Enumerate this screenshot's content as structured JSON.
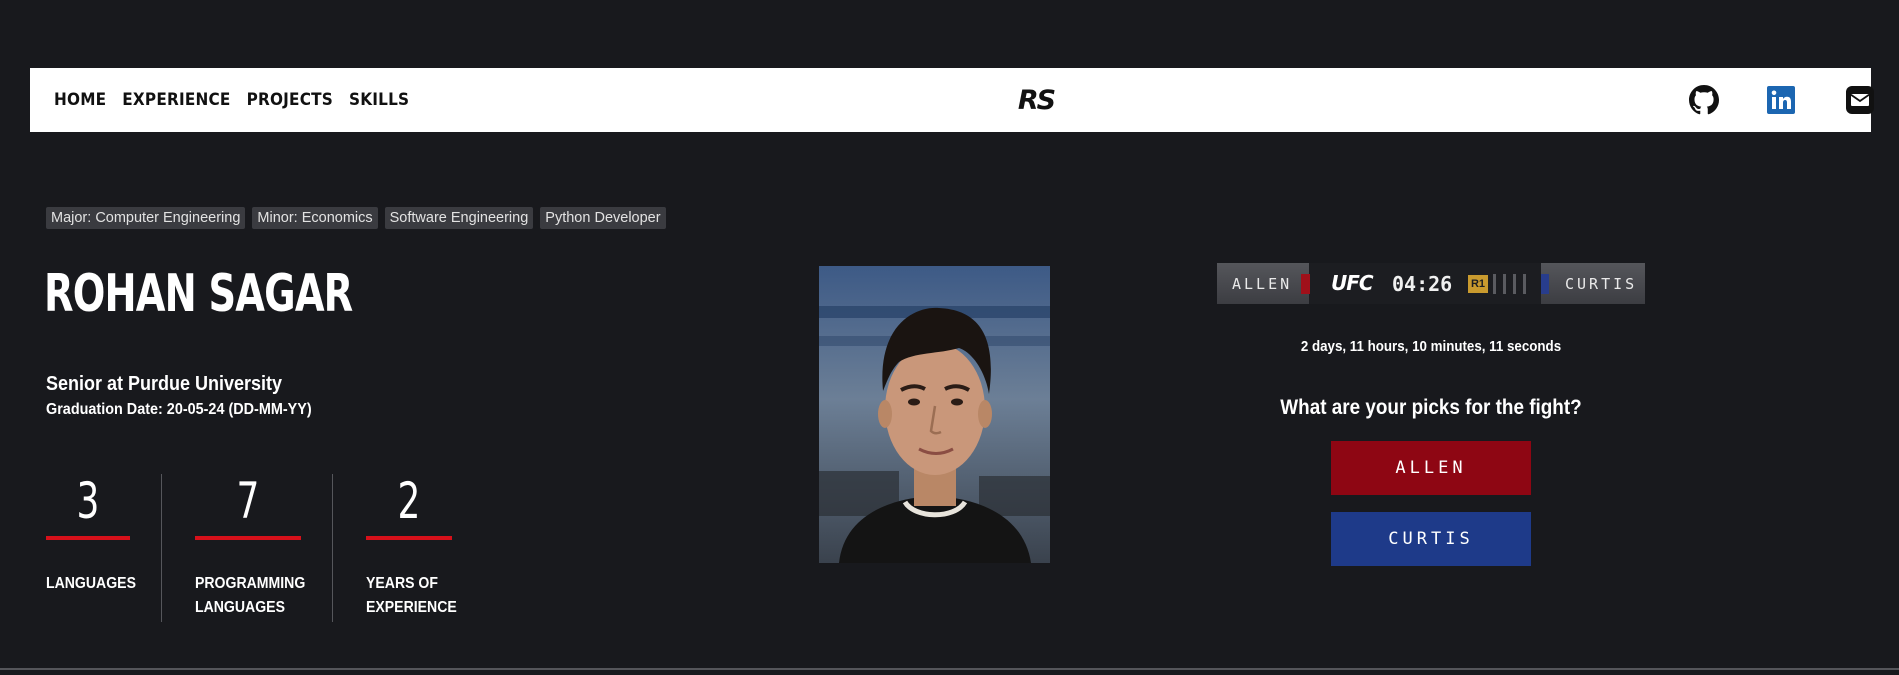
{
  "nav": {
    "links": [
      "HOME",
      "EXPERIENCE",
      "PROJECTS",
      "SKILLS"
    ],
    "logo_text": "RS",
    "social_icons": [
      "github-icon",
      "linkedin-icon",
      "mail-icon"
    ]
  },
  "tags": [
    "Major: Computer Engineering",
    "Minor: Economics",
    "Software Engineering",
    "Python Developer"
  ],
  "hero": {
    "name": "ROHAN SAGAR",
    "subtitle": "Senior at Purdue University",
    "graduation": "Graduation Date: 20-05-24 (DD-MM-YY)"
  },
  "stats": [
    {
      "value": "3",
      "label_line1": "LANGUAGES",
      "label_line2": ""
    },
    {
      "value": "7",
      "label_line1": "PROGRAMMING",
      "label_line2": "LANGUAGES"
    },
    {
      "value": "2",
      "label_line1": "YEARS OF",
      "label_line2": "EXPERIENCE"
    }
  ],
  "scoreboard": {
    "left_fighter": "ALLEN",
    "right_fighter": "CURTIS",
    "brand": "UFC",
    "clock": "04:26",
    "round": "R1"
  },
  "countdown": "2 days, 11 hours, 10 minutes, 11 seconds",
  "picks": {
    "question": "What are your picks for the fight?",
    "red_button": "ALLEN",
    "blue_button": "CURTIS"
  },
  "colors": {
    "background": "#18191d",
    "accent_red": "#d7101a",
    "fighter_red": "#8e0613",
    "fighter_blue": "#1e3a89",
    "round_gold": "#c99a2e",
    "linkedin_blue": "#1c66b1"
  }
}
